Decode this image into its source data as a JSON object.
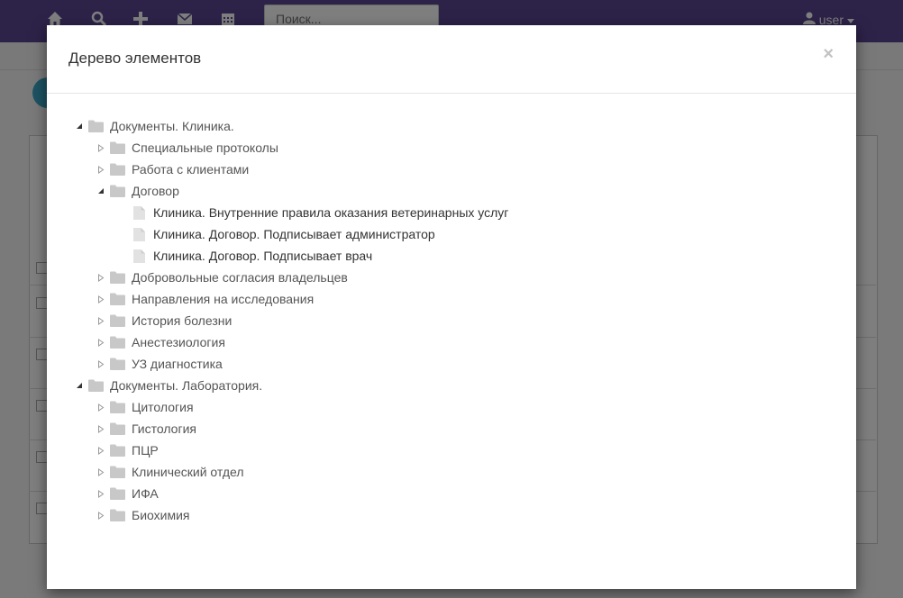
{
  "navbar": {
    "icons": [
      "home-icon",
      "search-icon",
      "plus-icon",
      "envelope-icon",
      "calendar-icon"
    ],
    "search_placeholder": "Поиск...",
    "user_label": "user"
  },
  "modal": {
    "title": "Дерево элементов",
    "close_label": "×"
  },
  "tree": [
    {
      "label": "Документы. Клиника.",
      "level": 0,
      "type": "folder",
      "expanded": true
    },
    {
      "label": "Специальные протоколы",
      "level": 1,
      "type": "folder",
      "expanded": false
    },
    {
      "label": "Работа с клиентами",
      "level": 1,
      "type": "folder",
      "expanded": false
    },
    {
      "label": "Договор",
      "level": 1,
      "type": "folder",
      "expanded": true
    },
    {
      "label": "Клиника. Внутренние правила оказания ветеринарных услуг",
      "level": 2,
      "type": "file"
    },
    {
      "label": "Клиника. Договор. Подписывает администратор",
      "level": 2,
      "type": "file"
    },
    {
      "label": "Клиника. Договор. Подписывает врач",
      "level": 2,
      "type": "file"
    },
    {
      "label": "Добровольные согласия владельцев",
      "level": 1,
      "type": "folder",
      "expanded": false
    },
    {
      "label": "Направления на исследования",
      "level": 1,
      "type": "folder",
      "expanded": false
    },
    {
      "label": "История болезни",
      "level": 1,
      "type": "folder",
      "expanded": false
    },
    {
      "label": "Анестезиология",
      "level": 1,
      "type": "folder",
      "expanded": false
    },
    {
      "label": "УЗ диагностика",
      "level": 1,
      "type": "folder",
      "expanded": false
    },
    {
      "label": "Документы. Лаборатория.",
      "level": 0,
      "type": "folder",
      "expanded": true
    },
    {
      "label": "Цитология",
      "level": 1,
      "type": "folder",
      "expanded": false
    },
    {
      "label": "Гистология",
      "level": 1,
      "type": "folder",
      "expanded": false
    },
    {
      "label": "ПЦР",
      "level": 1,
      "type": "folder",
      "expanded": false
    },
    {
      "label": "Клинический отдел",
      "level": 1,
      "type": "folder",
      "expanded": false
    },
    {
      "label": "ИФА",
      "level": 1,
      "type": "folder",
      "expanded": false
    },
    {
      "label": "Биохимия",
      "level": 1,
      "type": "folder",
      "expanded": false
    }
  ],
  "colors": {
    "navbar": "#5b4590",
    "tree_icon": "#c8c8c8",
    "caret": "#333333"
  }
}
